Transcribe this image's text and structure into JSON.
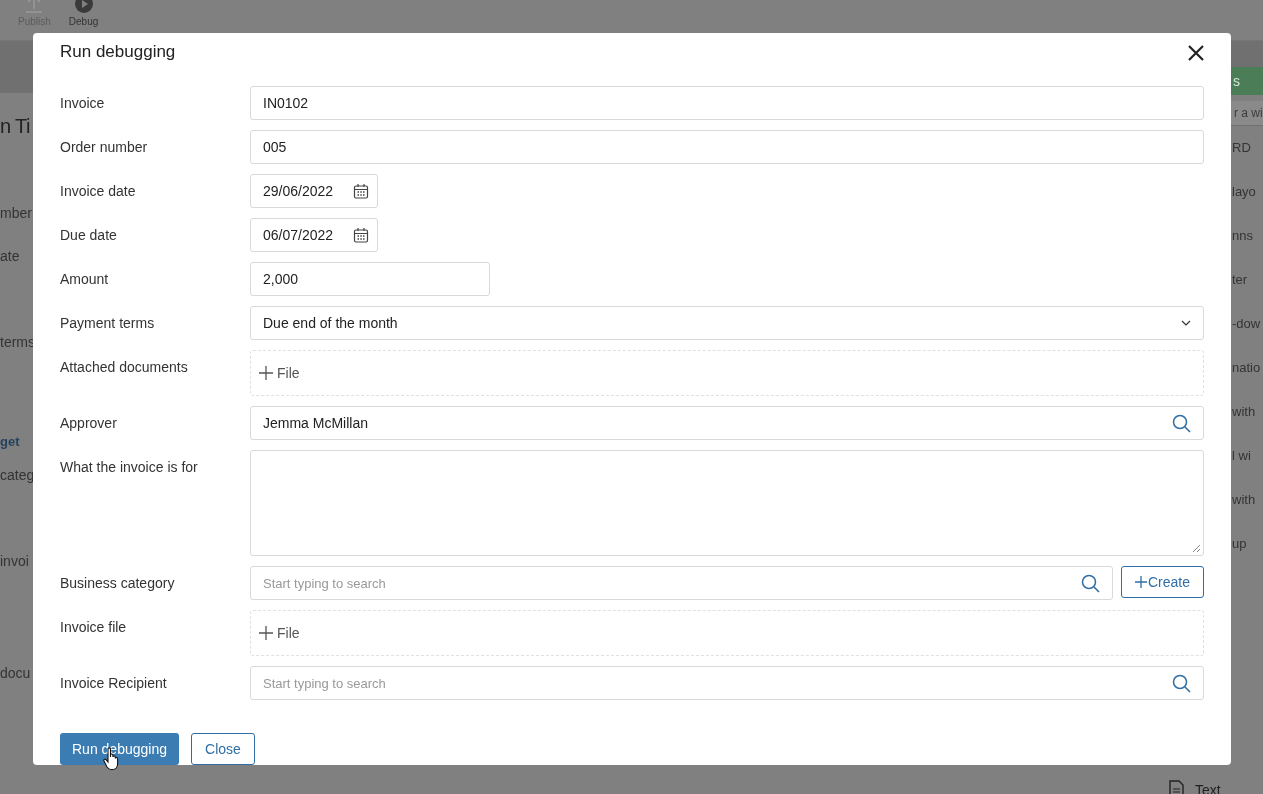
{
  "app_toolbar": {
    "buttons": [
      {
        "label": "Publish",
        "kind": "upload",
        "disabled": true
      },
      {
        "label": "Debug",
        "kind": "play",
        "disabled": false
      }
    ]
  },
  "background_left": [
    {
      "text": "n Ti",
      "kind": "heading"
    },
    {
      "text": "mber",
      "kind": "label"
    },
    {
      "text": "ate",
      "kind": "label"
    },
    {
      "text": "terms",
      "kind": "label"
    },
    {
      "text": "get",
      "kind": "link"
    },
    {
      "text": "categ",
      "kind": "label"
    },
    {
      "text": "invoi",
      "kind": "label"
    },
    {
      "text": "docu",
      "kind": "label"
    }
  ],
  "background_right": {
    "button": "s",
    "search_placeholder": "r a wi",
    "items": [
      "RD",
      "layo",
      "nns",
      "ter",
      "-dow",
      "natio",
      "with",
      "l wi",
      "with",
      "up"
    ],
    "bottom_item": "Text"
  },
  "dialog": {
    "title": "Run debugging",
    "fields": [
      {
        "label": "Invoice",
        "kind": "text",
        "value": "IN0102"
      },
      {
        "label": "Order number",
        "kind": "text",
        "value": "005"
      },
      {
        "label": "Invoice date",
        "kind": "date",
        "value": "29/06/2022"
      },
      {
        "label": "Due date",
        "kind": "date",
        "value": "06/07/2022"
      },
      {
        "label": "Amount",
        "kind": "short",
        "value": "2,000"
      },
      {
        "label": "Payment terms",
        "kind": "select",
        "value": "Due end of the month"
      },
      {
        "label": "Attached documents",
        "kind": "file",
        "button": "File"
      },
      {
        "label": "Approver",
        "kind": "search",
        "value": "Jemma McMillan"
      },
      {
        "label": "What the invoice is for",
        "kind": "textarea"
      },
      {
        "label": "Business category",
        "kind": "search_create",
        "placeholder": "Start typing to search",
        "button": "Create"
      },
      {
        "label": "Invoice file",
        "kind": "file",
        "button": "File"
      },
      {
        "label": "Invoice Recipient",
        "kind": "search",
        "placeholder": "Start typing to search"
      }
    ],
    "buttons": [
      {
        "label": "Run debugging",
        "kind": "primary"
      },
      {
        "label": "Close",
        "kind": "secondary"
      }
    ]
  }
}
